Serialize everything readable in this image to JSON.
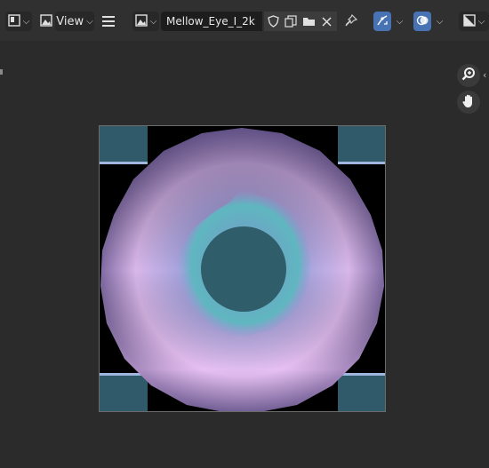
{
  "header": {
    "editor_type_icon": "image-editor-icon",
    "view_mode_icon": "image-mode-icon",
    "view_menu_label": "View",
    "hamburger_icon": "menu-icon",
    "image_browse_icon": "image-browse-icon",
    "image_name": "Mellow_Eye_I_2k",
    "fake_user_icon": "shield-icon",
    "duplicate_icon": "duplicate-icon",
    "open_icon": "folder-icon",
    "unlink_icon": "close-icon",
    "pin_icon": "pin-icon",
    "uv_sync_icon": "uv-sync-icon",
    "overlay_icon": "overlay-icon",
    "display_channels_icon": "display-channels-icon"
  },
  "tools": {
    "zoom_icon": "zoom-icon",
    "pan_icon": "hand-icon"
  },
  "colors": {
    "accent": "#4772b3",
    "tile": "#305a6a",
    "pupil": "#2f5d6a"
  }
}
